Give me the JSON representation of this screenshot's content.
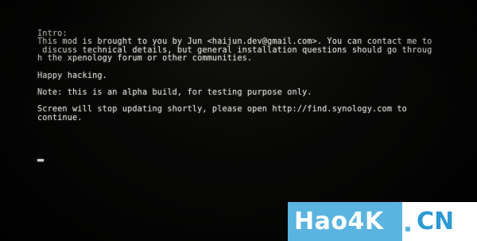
{
  "console": {
    "lines": [
      "Intro:",
      "This mod is brought to you by Jun <haijun.dev@gmail.com>. You can contact me to",
      " discuss technical details, but general installation questions should go throug",
      "h the xpenology forum or other communities.",
      "",
      "Happy hacking.",
      "",
      "Note: this is an alpha build, for testing purpose only.",
      "",
      "Screen will stop updating shortly, please open http://find.synology.com to",
      "continue."
    ]
  },
  "watermark": {
    "left_text": "Hao4K",
    "right_text": "CN"
  },
  "colors": {
    "text": "#dcdcd6",
    "background": "#000000",
    "watermark_blue": "#5bb4e0",
    "watermark_text_blue": "#2e9ad4"
  }
}
